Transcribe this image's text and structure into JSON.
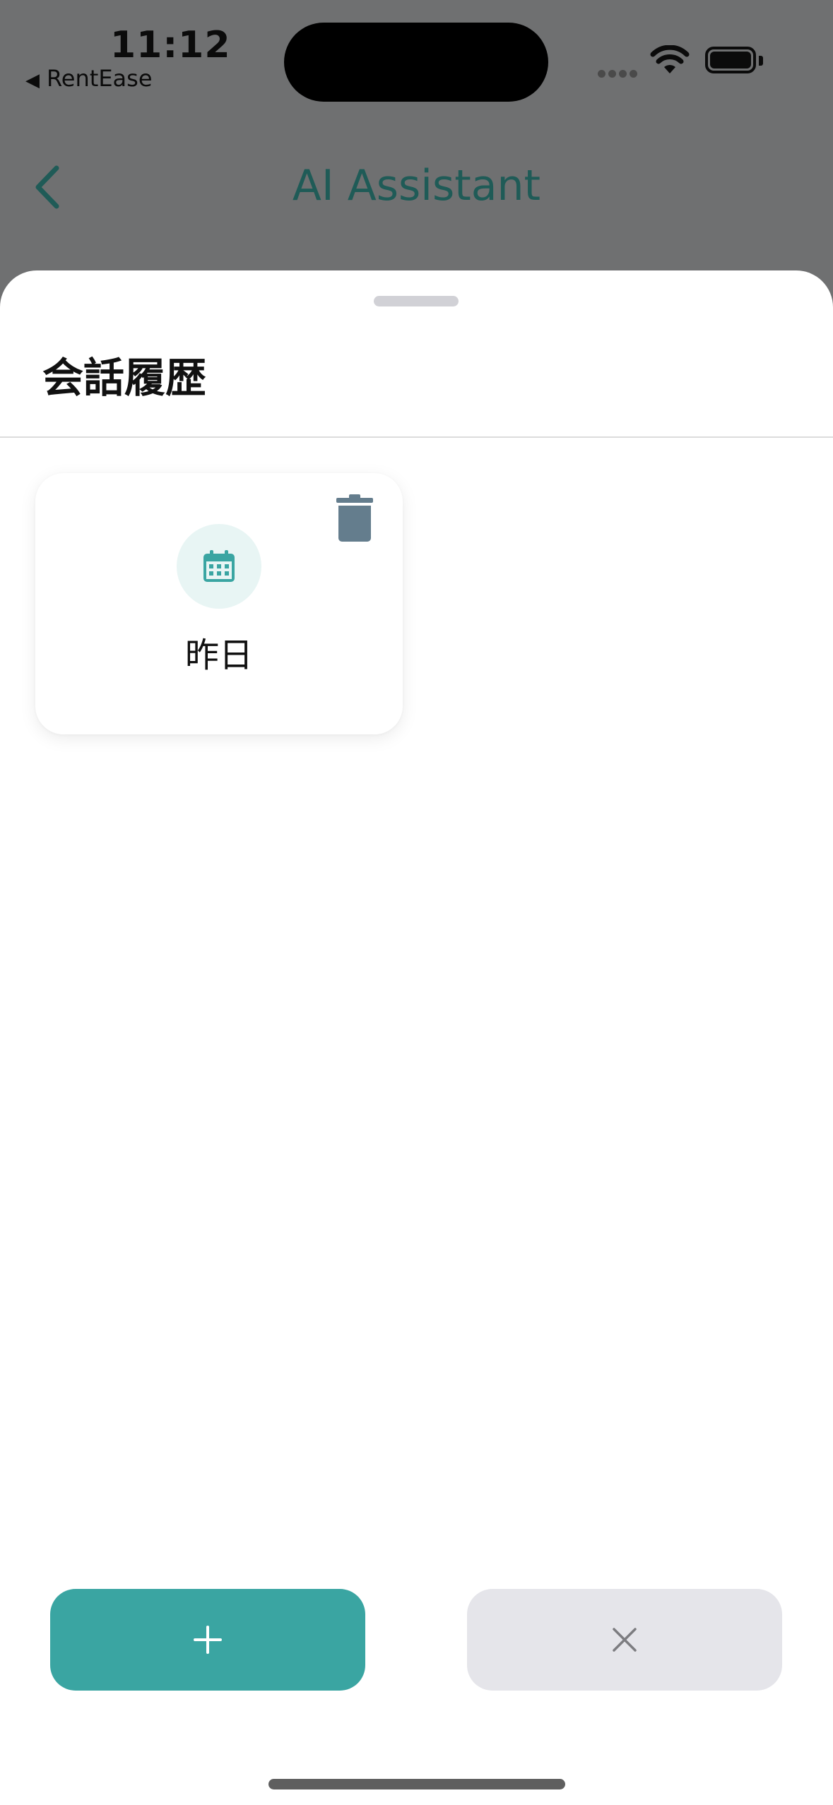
{
  "status_bar": {
    "time": "11:12",
    "back_app_label": "RentEase"
  },
  "nav": {
    "title": "AI Assistant"
  },
  "sheet": {
    "title": "会話履歴",
    "history_items": [
      {
        "label": "昨日",
        "icon": "calendar-icon"
      }
    ]
  },
  "actions": {
    "new_icon": "plus-icon",
    "close_icon": "close-icon"
  },
  "colors": {
    "accent": "#3aa5a2",
    "title_teal": "#1f5b57",
    "trash": "#647d8d",
    "button_gray": "#e5e5ea"
  }
}
